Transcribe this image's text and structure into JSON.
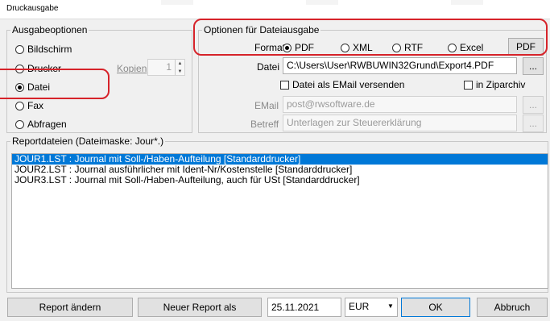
{
  "window": {
    "title": "Druckausgabe"
  },
  "ausgabe": {
    "legend": "Ausgabeoptionen",
    "options": [
      "Bildschirm",
      "Drucker",
      "Datei",
      "Fax",
      "Abfragen"
    ],
    "selected": "Datei",
    "kopien_label": "Kopien",
    "kopien_value": "1"
  },
  "optionen": {
    "legend": "Optionen für Dateiausgabe",
    "format_label": "Format",
    "formats": [
      "PDF",
      "XML",
      "RTF",
      "Excel"
    ],
    "selected_format": "PDF",
    "format_button": "PDF",
    "datei_label": "Datei",
    "datei_value": "C:\\Users\\User\\RWBUWIN32Grund\\Export4.PDF",
    "browse": "...",
    "email_checkbox": "Datei als EMail versenden",
    "zip_checkbox": "in Ziparchiv",
    "email_label": "EMail",
    "email_value": "post@rwsoftware.de",
    "betreff_label": "Betreff",
    "betreff_value": "Unterlagen zur Steuererklärung"
  },
  "reports": {
    "legend": "Reportdateien  (Dateimaske: Jour*.)",
    "items": [
      "JOUR1.LST : Journal mit Soll-/Haben-Aufteilung [Standarddrucker]",
      "JOUR2.LST : Journal ausführlicher mit Ident-Nr/Kostenstelle [Standarddrucker]",
      "JOUR3.LST : Journal mit Soll-/Haben-Aufteilung, auch für USt [Standarddrucker]"
    ]
  },
  "footer": {
    "report_aendern": "Report ändern",
    "neuer_report": "Neuer Report als",
    "date": "25.11.2021",
    "currency": "EUR",
    "ok": "OK",
    "abbruch": "Abbruch"
  }
}
